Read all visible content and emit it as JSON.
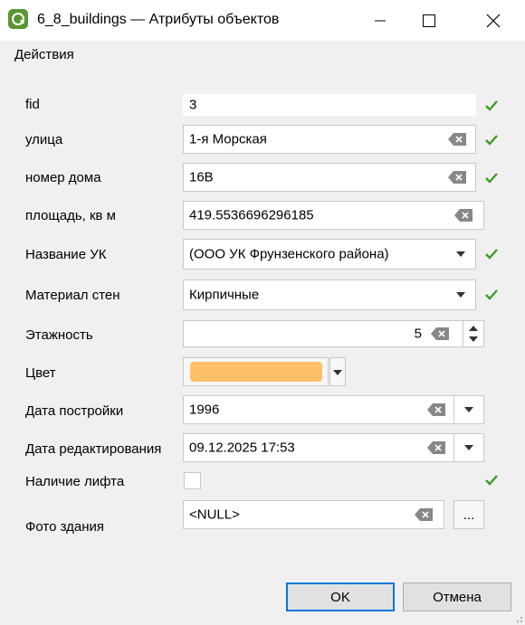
{
  "window": {
    "title": "6_8_buildings — Атрибуты объектов"
  },
  "menu": {
    "actions": "Действия"
  },
  "fields": {
    "fid": {
      "label": "fid",
      "value": "3"
    },
    "street": {
      "label": "улица",
      "value": "1-я Морская"
    },
    "house": {
      "label": "номер дома",
      "value": "16В"
    },
    "area": {
      "label": "площадь, кв м",
      "value": "419.5536696296185"
    },
    "uk": {
      "label": "Название УК",
      "value": "(ООО УК Фрунзенского района)"
    },
    "material": {
      "label": "Материал стен",
      "value": "Кирпичные"
    },
    "floors": {
      "label": "Этажность",
      "value": "5"
    },
    "color": {
      "label": "Цвет",
      "value": "#ffbf6b"
    },
    "built": {
      "label": "Дата постройки",
      "value": "1996"
    },
    "edited": {
      "label": "Дата редактирования",
      "value": "09.12.2025 17:53"
    },
    "lift": {
      "label": "Наличие лифта",
      "checked": false
    },
    "photo": {
      "label": "Фото здания",
      "value": "<NULL>",
      "browse": "..."
    }
  },
  "buttons": {
    "ok": "OK",
    "cancel": "Отмена"
  },
  "colors": {
    "check": "#3f9b2a",
    "ok_border": "#0078d7",
    "accent": "#589632"
  }
}
